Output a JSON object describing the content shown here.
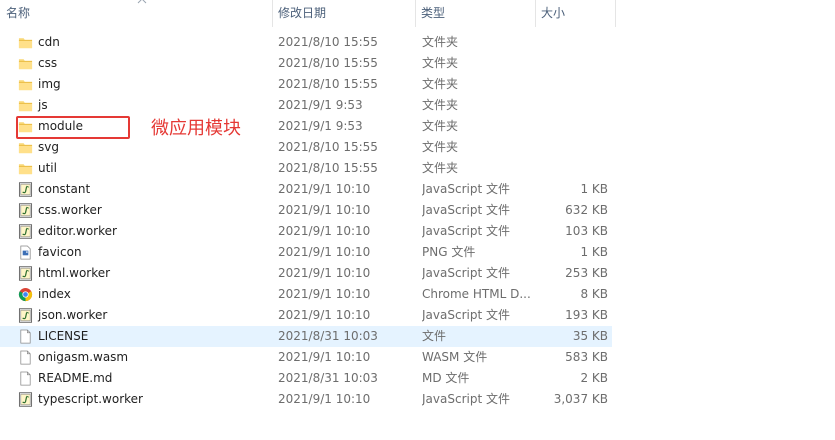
{
  "columns": {
    "name": "名称",
    "date": "修改日期",
    "type": "类型",
    "size": "大小"
  },
  "annotation": {
    "text": "微应用模块",
    "color": "#e53935"
  },
  "files": [
    {
      "name": "cdn",
      "date": "2021/8/10 15:55",
      "type": "文件夹",
      "size": "",
      "icon": "folder-icon"
    },
    {
      "name": "css",
      "date": "2021/8/10 15:55",
      "type": "文件夹",
      "size": "",
      "icon": "folder-icon"
    },
    {
      "name": "img",
      "date": "2021/8/10 15:55",
      "type": "文件夹",
      "size": "",
      "icon": "folder-icon"
    },
    {
      "name": "js",
      "date": "2021/9/1 9:53",
      "type": "文件夹",
      "size": "",
      "icon": "folder-icon"
    },
    {
      "name": "module",
      "date": "2021/9/1 9:53",
      "type": "文件夹",
      "size": "",
      "icon": "folder-icon"
    },
    {
      "name": "svg",
      "date": "2021/8/10 15:55",
      "type": "文件夹",
      "size": "",
      "icon": "folder-icon"
    },
    {
      "name": "util",
      "date": "2021/8/10 15:55",
      "type": "文件夹",
      "size": "",
      "icon": "folder-icon"
    },
    {
      "name": "constant",
      "date": "2021/9/1 10:10",
      "type": "JavaScript 文件",
      "size": "1 KB",
      "icon": "javascript-file-icon"
    },
    {
      "name": "css.worker",
      "date": "2021/9/1 10:10",
      "type": "JavaScript 文件",
      "size": "632 KB",
      "icon": "javascript-file-icon"
    },
    {
      "name": "editor.worker",
      "date": "2021/9/1 10:10",
      "type": "JavaScript 文件",
      "size": "103 KB",
      "icon": "javascript-file-icon"
    },
    {
      "name": "favicon",
      "date": "2021/9/1 10:10",
      "type": "PNG 文件",
      "size": "1 KB",
      "icon": "png-file-icon"
    },
    {
      "name": "html.worker",
      "date": "2021/9/1 10:10",
      "type": "JavaScript 文件",
      "size": "253 KB",
      "icon": "javascript-file-icon"
    },
    {
      "name": "index",
      "date": "2021/9/1 10:10",
      "type": "Chrome HTML D...",
      "size": "8 KB",
      "icon": "chrome-icon"
    },
    {
      "name": "json.worker",
      "date": "2021/9/1 10:10",
      "type": "JavaScript 文件",
      "size": "193 KB",
      "icon": "javascript-file-icon"
    },
    {
      "name": "LICENSE",
      "date": "2021/8/31 10:03",
      "type": "文件",
      "size": "35 KB",
      "icon": "blank-file-icon",
      "selected": true
    },
    {
      "name": "onigasm.wasm",
      "date": "2021/9/1 10:10",
      "type": "WASM 文件",
      "size": "583 KB",
      "icon": "blank-file-icon"
    },
    {
      "name": "README.md",
      "date": "2021/8/31 10:03",
      "type": "MD 文件",
      "size": "2 KB",
      "icon": "blank-file-icon"
    },
    {
      "name": "typescript.worker",
      "date": "2021/9/1 10:10",
      "type": "JavaScript 文件",
      "size": "3,037 KB",
      "icon": "javascript-file-icon"
    }
  ]
}
